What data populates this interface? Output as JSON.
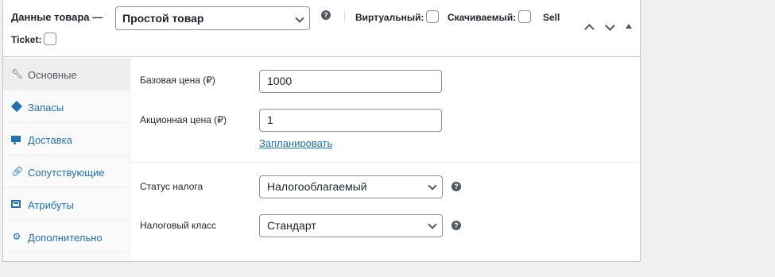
{
  "header": {
    "title": "Данные товара —",
    "product_type": "Простой товар",
    "help": "?",
    "options": {
      "virtual": "Виртуальный:",
      "downloadable": "Скачиваемый:",
      "sell": "Sell",
      "ticket": "Ticket:"
    }
  },
  "tabs": [
    {
      "label": "Основные",
      "icon": "wrench-icon",
      "active": true
    },
    {
      "label": "Запасы",
      "icon": "inventory-icon",
      "active": false
    },
    {
      "label": "Доставка",
      "icon": "truck-icon",
      "active": false
    },
    {
      "label": "Сопутствующие",
      "icon": "link-icon",
      "active": false
    },
    {
      "label": "Атрибуты",
      "icon": "list-icon",
      "active": false
    },
    {
      "label": "Дополнительно",
      "icon": "gear-icon",
      "active": false
    }
  ],
  "general": {
    "regular_price_label": "Базовая цена (₽)",
    "regular_price": "1000",
    "sale_price_label": "Акционная цена (₽)",
    "sale_price": "1",
    "schedule_link": "Запланировать",
    "tax_status_label": "Статус налога",
    "tax_status": "Налогооблагаемый",
    "tax_class_label": "Налоговый класс",
    "tax_class": "Стандарт"
  },
  "colors": {
    "accent": "#2271b1",
    "border": "#c3c4c7",
    "background": "#f0f0f1"
  }
}
